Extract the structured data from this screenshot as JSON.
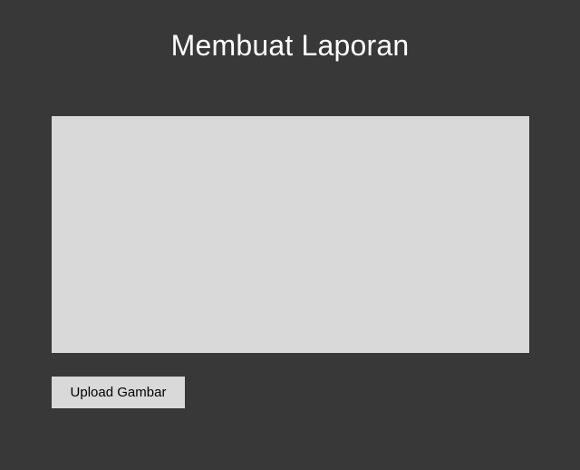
{
  "page": {
    "title": "Membuat Laporan"
  },
  "upload": {
    "button_label": "Upload Gambar"
  },
  "colors": {
    "background": "#383838",
    "title_text": "#ffffff",
    "preview_area": "#d9d9d9",
    "button_background": "#d9d9d9",
    "button_text": "#000000"
  }
}
